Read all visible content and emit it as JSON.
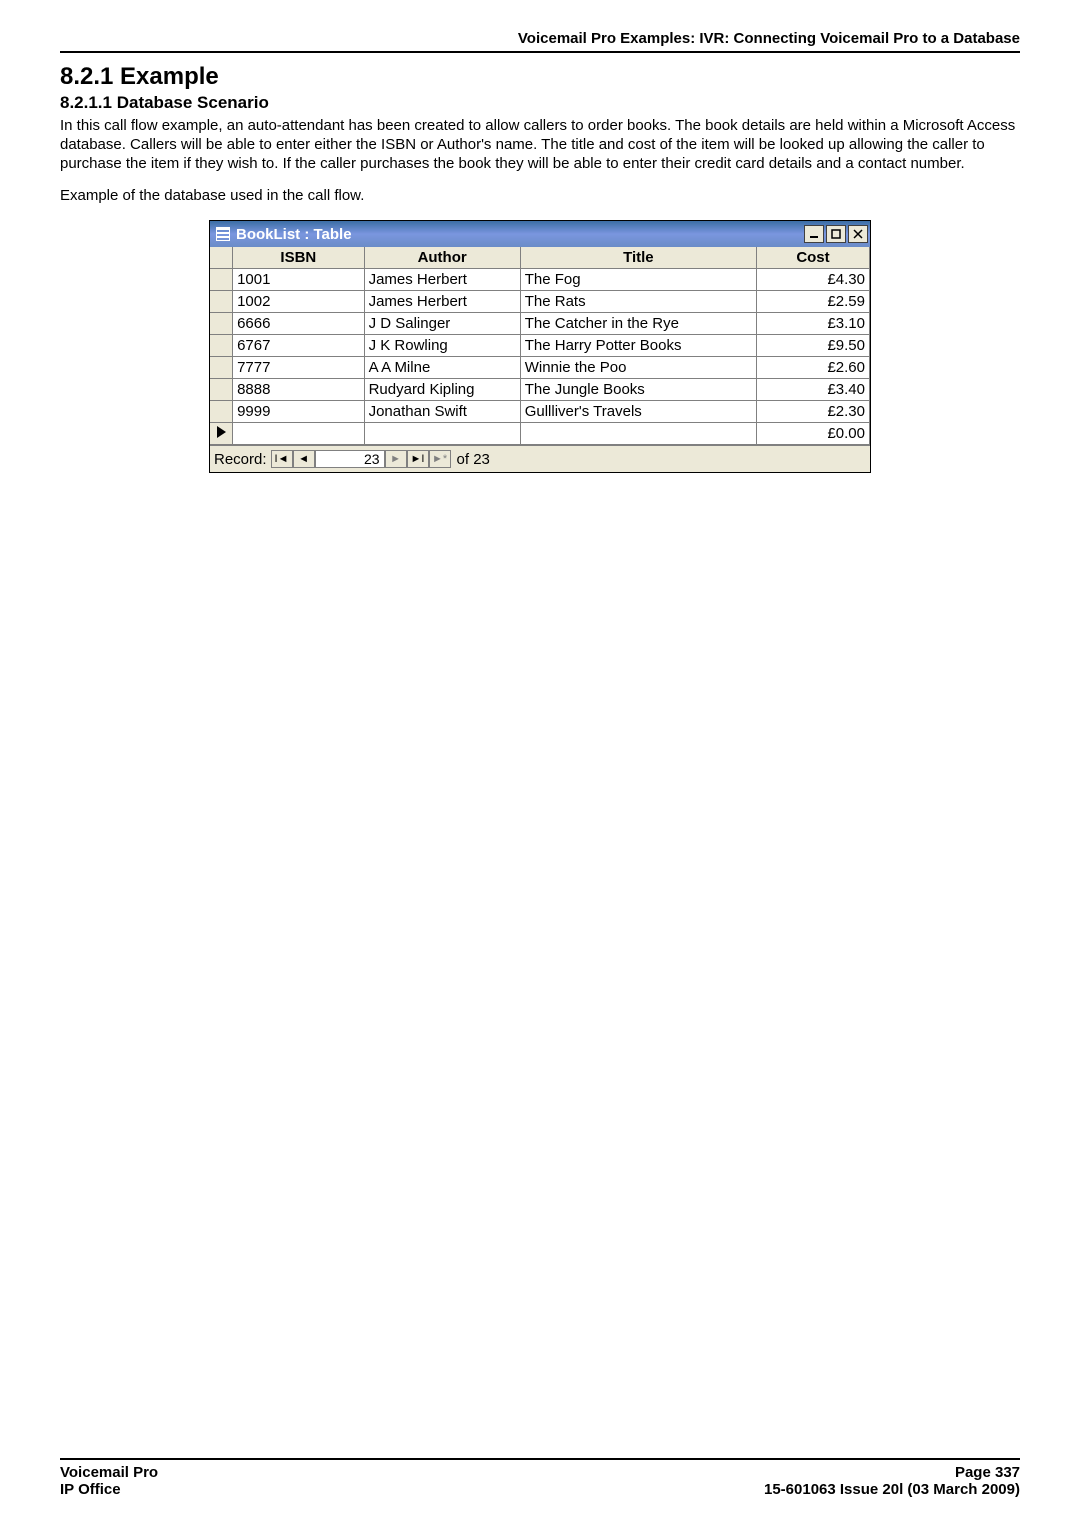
{
  "header": {
    "breadcrumb": "Voicemail Pro Examples: IVR: Connecting Voicemail Pro to a Database"
  },
  "headings": {
    "h1": "8.2.1 Example",
    "h2": "8.2.1.1 Database Scenario"
  },
  "body": {
    "p1": "In this call flow example, an auto-attendant has been created to allow callers to order books. The book details are held within a Microsoft Access database. Callers will be able to enter either the ISBN or Author's name. The title and cost of the item will be looked up allowing the caller to purchase the item if they wish to. If the caller purchases the book they will be able to enter their credit card details and a contact number.",
    "p2": "Example of the database used in the call flow."
  },
  "window": {
    "title": "BookList : Table"
  },
  "columns": {
    "isbn": "ISBN",
    "author": "Author",
    "title": "Title",
    "cost": "Cost"
  },
  "rows": [
    {
      "isbn": "1001",
      "author": "James Herbert",
      "title": "The Fog",
      "cost": "£4.30"
    },
    {
      "isbn": "1002",
      "author": "James Herbert",
      "title": "The Rats",
      "cost": "£2.59"
    },
    {
      "isbn": "6666",
      "author": "J D Salinger",
      "title": "The Catcher in the Rye",
      "cost": "£3.10"
    },
    {
      "isbn": "6767",
      "author": "J K Rowling",
      "title": "The Harry Potter Books",
      "cost": "£9.50"
    },
    {
      "isbn": "7777",
      "author": "A A Milne",
      "title": "Winnie the Poo",
      "cost": "£2.60"
    },
    {
      "isbn": "8888",
      "author": "Rudyard Kipling",
      "title": "The Jungle Books",
      "cost": "£3.40"
    },
    {
      "isbn": "9999",
      "author": "Jonathan Swift",
      "title": "Gullliver's Travels",
      "cost": "£2.30"
    }
  ],
  "newrow_cost": "£0.00",
  "nav": {
    "label": "Record:",
    "current": "23",
    "of_label": "of  23"
  },
  "footer": {
    "left1": "Voicemail Pro",
    "left2": "IP Office",
    "right1": "Page 337",
    "right2": "15-601063 Issue 20l (03 March 2009)"
  }
}
